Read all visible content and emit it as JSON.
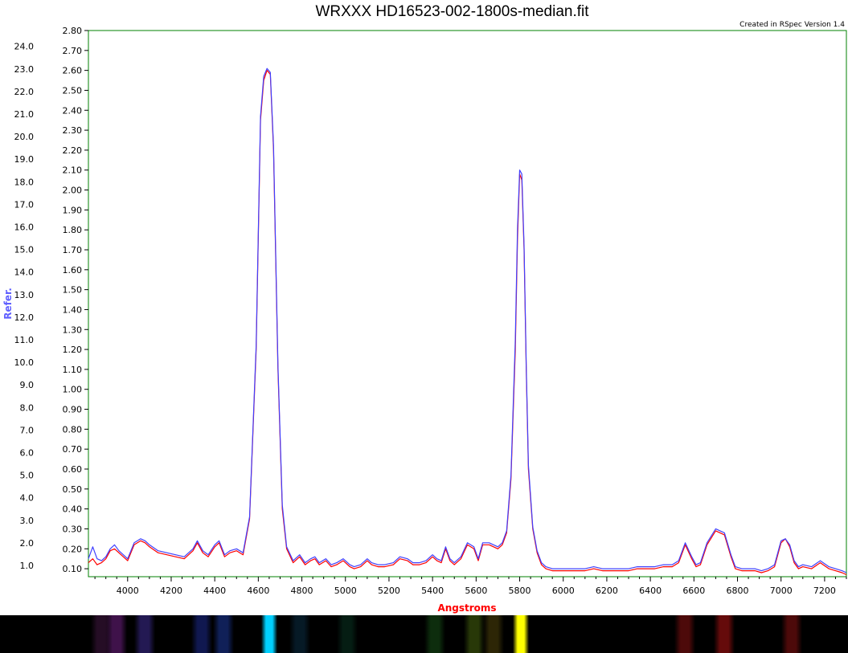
{
  "chart_data": {
    "type": "line",
    "title": "WRXXX HD16523-002-1800s-median.fit",
    "credit": "Created in RSpec Version 1.4",
    "xlabel": "Angstroms",
    "ylabel": "Refer.",
    "xlim": [
      3820,
      7300
    ],
    "ylim": [
      0.06,
      2.8
    ],
    "grid": false,
    "x_ticks": [
      4000,
      4200,
      4400,
      4600,
      4800,
      5000,
      5200,
      5400,
      5600,
      5800,
      6000,
      6200,
      6400,
      6600,
      6800,
      7000,
      7200
    ],
    "y_ticks": [
      "0.10",
      "0.20",
      "0.30",
      "0.40",
      "0.50",
      "0.60",
      "0.70",
      "0.80",
      "0.90",
      "1.00",
      "1.10",
      "1.20",
      "1.30",
      "1.40",
      "1.50",
      "1.60",
      "1.70",
      "1.80",
      "1.90",
      "2.00",
      "2.10",
      "2.20",
      "2.30",
      "2.40",
      "2.50",
      "2.60",
      "2.70",
      "2.80"
    ],
    "y2_ticks": [
      "1.0",
      "2.0",
      "3.0",
      "4.0",
      "5.0",
      "6.0",
      "7.0",
      "8.0",
      "9.0",
      "10.0",
      "11.0",
      "12.0",
      "13.0",
      "14.0",
      "15.0",
      "16.0",
      "17.0",
      "18.0",
      "19.0",
      "20.0",
      "21.0",
      "22.0",
      "23.0",
      "24.0"
    ],
    "y2lim": [
      0.5,
      24.7
    ],
    "series": [
      {
        "color": "#ff0000",
        "x": [
          3820,
          3840,
          3860,
          3880,
          3900,
          3920,
          3940,
          3960,
          3980,
          4000,
          4030,
          4060,
          4080,
          4100,
          4140,
          4180,
          4220,
          4260,
          4300,
          4320,
          4345,
          4370,
          4400,
          4420,
          4445,
          4470,
          4500,
          4530,
          4560,
          4590,
          4610,
          4625,
          4640,
          4655,
          4670,
          4690,
          4710,
          4730,
          4760,
          4790,
          4815,
          4840,
          4860,
          4880,
          4910,
          4935,
          4960,
          4990,
          5020,
          5040,
          5070,
          5100,
          5120,
          5150,
          5180,
          5220,
          5250,
          5285,
          5310,
          5340,
          5370,
          5400,
          5420,
          5440,
          5460,
          5480,
          5500,
          5530,
          5560,
          5590,
          5610,
          5630,
          5660,
          5680,
          5700,
          5720,
          5740,
          5760,
          5780,
          5790,
          5800,
          5810,
          5820,
          5830,
          5840,
          5860,
          5880,
          5900,
          5920,
          5950,
          5980,
          6020,
          6060,
          6100,
          6140,
          6180,
          6220,
          6260,
          6300,
          6340,
          6380,
          6420,
          6460,
          6500,
          6530,
          6560,
          6590,
          6610,
          6630,
          6660,
          6700,
          6740,
          6770,
          6790,
          6820,
          6850,
          6880,
          6910,
          6940,
          6970,
          7000,
          7020,
          7040,
          7060,
          7080,
          7100,
          7140,
          7180,
          7220,
          7250,
          7280,
          7300
        ],
        "y": [
          0.13,
          0.15,
          0.12,
          0.13,
          0.15,
          0.19,
          0.2,
          0.18,
          0.16,
          0.14,
          0.22,
          0.24,
          0.23,
          0.21,
          0.18,
          0.17,
          0.16,
          0.15,
          0.19,
          0.23,
          0.18,
          0.16,
          0.21,
          0.23,
          0.16,
          0.18,
          0.19,
          0.17,
          0.35,
          1.2,
          2.35,
          2.55,
          2.6,
          2.58,
          2.2,
          1.1,
          0.4,
          0.2,
          0.13,
          0.16,
          0.12,
          0.14,
          0.15,
          0.12,
          0.14,
          0.11,
          0.12,
          0.14,
          0.11,
          0.1,
          0.11,
          0.14,
          0.12,
          0.11,
          0.11,
          0.12,
          0.15,
          0.14,
          0.12,
          0.12,
          0.13,
          0.16,
          0.14,
          0.13,
          0.2,
          0.14,
          0.12,
          0.15,
          0.22,
          0.2,
          0.14,
          0.22,
          0.22,
          0.21,
          0.2,
          0.22,
          0.28,
          0.55,
          1.2,
          1.75,
          2.08,
          2.05,
          1.7,
          1.1,
          0.6,
          0.3,
          0.18,
          0.12,
          0.1,
          0.09,
          0.09,
          0.09,
          0.09,
          0.09,
          0.1,
          0.09,
          0.09,
          0.09,
          0.09,
          0.1,
          0.1,
          0.1,
          0.11,
          0.11,
          0.13,
          0.22,
          0.15,
          0.11,
          0.12,
          0.22,
          0.29,
          0.27,
          0.16,
          0.1,
          0.09,
          0.09,
          0.09,
          0.08,
          0.09,
          0.11,
          0.23,
          0.25,
          0.21,
          0.13,
          0.1,
          0.11,
          0.1,
          0.13,
          0.1,
          0.09,
          0.08,
          0.07
        ]
      },
      {
        "color": "#4040ff",
        "x": [
          3820,
          3840,
          3860,
          3880,
          3900,
          3920,
          3940,
          3960,
          3980,
          4000,
          4030,
          4060,
          4080,
          4100,
          4140,
          4180,
          4220,
          4260,
          4300,
          4320,
          4345,
          4370,
          4400,
          4420,
          4445,
          4470,
          4500,
          4530,
          4560,
          4590,
          4610,
          4625,
          4640,
          4655,
          4670,
          4690,
          4710,
          4730,
          4760,
          4790,
          4815,
          4840,
          4860,
          4880,
          4910,
          4935,
          4960,
          4990,
          5020,
          5040,
          5070,
          5100,
          5120,
          5150,
          5180,
          5220,
          5250,
          5285,
          5310,
          5340,
          5370,
          5400,
          5420,
          5440,
          5460,
          5480,
          5500,
          5530,
          5560,
          5590,
          5610,
          5630,
          5660,
          5680,
          5700,
          5720,
          5740,
          5760,
          5780,
          5790,
          5800,
          5810,
          5820,
          5830,
          5840,
          5860,
          5880,
          5900,
          5920,
          5950,
          5980,
          6020,
          6060,
          6100,
          6140,
          6180,
          6220,
          6260,
          6300,
          6340,
          6380,
          6420,
          6460,
          6500,
          6530,
          6560,
          6590,
          6610,
          6630,
          6660,
          6700,
          6740,
          6770,
          6790,
          6820,
          6850,
          6880,
          6910,
          6940,
          6970,
          7000,
          7020,
          7040,
          7060,
          7080,
          7100,
          7140,
          7180,
          7220,
          7250,
          7280,
          7300
        ],
        "y": [
          0.15,
          0.21,
          0.15,
          0.14,
          0.16,
          0.2,
          0.22,
          0.19,
          0.17,
          0.15,
          0.23,
          0.25,
          0.24,
          0.22,
          0.19,
          0.18,
          0.17,
          0.16,
          0.2,
          0.24,
          0.19,
          0.17,
          0.22,
          0.24,
          0.17,
          0.19,
          0.2,
          0.18,
          0.36,
          1.22,
          2.37,
          2.57,
          2.61,
          2.59,
          2.22,
          1.12,
          0.42,
          0.21,
          0.14,
          0.17,
          0.13,
          0.15,
          0.16,
          0.13,
          0.15,
          0.12,
          0.13,
          0.15,
          0.12,
          0.11,
          0.12,
          0.15,
          0.13,
          0.12,
          0.12,
          0.13,
          0.16,
          0.15,
          0.13,
          0.13,
          0.14,
          0.17,
          0.15,
          0.14,
          0.21,
          0.15,
          0.13,
          0.16,
          0.23,
          0.21,
          0.15,
          0.23,
          0.23,
          0.22,
          0.21,
          0.23,
          0.29,
          0.57,
          1.25,
          1.8,
          2.1,
          2.08,
          1.72,
          1.12,
          0.62,
          0.31,
          0.19,
          0.13,
          0.11,
          0.1,
          0.1,
          0.1,
          0.1,
          0.1,
          0.11,
          0.1,
          0.1,
          0.1,
          0.1,
          0.11,
          0.11,
          0.11,
          0.12,
          0.12,
          0.14,
          0.23,
          0.16,
          0.12,
          0.13,
          0.23,
          0.3,
          0.28,
          0.17,
          0.11,
          0.1,
          0.1,
          0.1,
          0.09,
          0.1,
          0.12,
          0.24,
          0.25,
          0.22,
          0.14,
          0.11,
          0.12,
          0.11,
          0.14,
          0.11,
          0.1,
          0.09,
          0.08
        ]
      }
    ],
    "spectrum_strip": [
      {
        "wavelength": 3880,
        "color": "#4a1a4a",
        "intensity": 0.5
      },
      {
        "wavelength": 3950,
        "color": "#5a1a6a",
        "intensity": 0.7
      },
      {
        "wavelength": 4080,
        "color": "#3a2a8a",
        "intensity": 0.6
      },
      {
        "wavelength": 4340,
        "color": "#2030a0",
        "intensity": 0.5
      },
      {
        "wavelength": 4440,
        "color": "#2040b0",
        "intensity": 0.5
      },
      {
        "wavelength": 4650,
        "color": "#00d0ff",
        "intensity": 1.0
      },
      {
        "wavelength": 4790,
        "color": "#104060",
        "intensity": 0.4
      },
      {
        "wavelength": 5010,
        "color": "#106040",
        "intensity": 0.3
      },
      {
        "wavelength": 5410,
        "color": "#207020",
        "intensity": 0.4
      },
      {
        "wavelength": 5590,
        "color": "#507010",
        "intensity": 0.5
      },
      {
        "wavelength": 5680,
        "color": "#706010",
        "intensity": 0.4
      },
      {
        "wavelength": 5805,
        "color": "#ffff00",
        "intensity": 1.0
      },
      {
        "wavelength": 6560,
        "color": "#801010",
        "intensity": 0.6
      },
      {
        "wavelength": 6740,
        "color": "#901010",
        "intensity": 0.7
      },
      {
        "wavelength": 7050,
        "color": "#801010",
        "intensity": 0.6
      }
    ]
  }
}
